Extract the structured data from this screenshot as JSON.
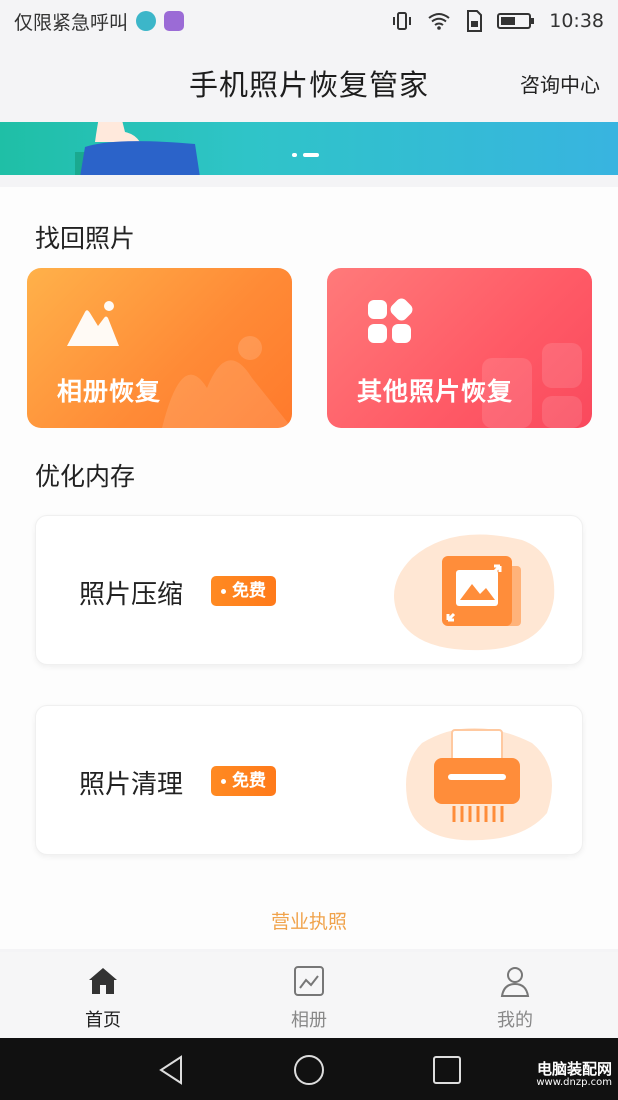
{
  "status_bar": {
    "left_text": "仅限紧急呼叫",
    "time": "10:38"
  },
  "header": {
    "title": "手机照片恢复管家",
    "action": "咨询中心"
  },
  "sections": {
    "recover_title": "找回照片",
    "optimize_title": "优化内存"
  },
  "recover_cards": [
    {
      "label": "相册恢复",
      "icon": "mountain-icon",
      "color": "#ff8a36"
    },
    {
      "label": "其他照片恢复",
      "icon": "apps-grid-icon",
      "color": "#ff5a66"
    }
  ],
  "optimize_cards": [
    {
      "label": "照片压缩",
      "badge": "免费",
      "icon": "compress-image-icon"
    },
    {
      "label": "照片清理",
      "badge": "免费",
      "icon": "shredder-icon"
    }
  ],
  "license_link": "营业执照",
  "bottom_nav": [
    {
      "label": "首页",
      "icon": "home-icon",
      "active": true
    },
    {
      "label": "相册",
      "icon": "album-icon",
      "active": false
    },
    {
      "label": "我的",
      "icon": "user-icon",
      "active": false
    }
  ],
  "watermark": {
    "line1": "电脑装配网",
    "line2": "www.dnzp.com"
  }
}
